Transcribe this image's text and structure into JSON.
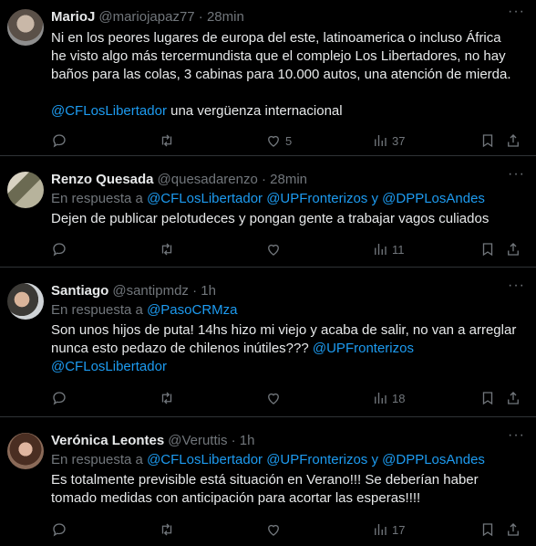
{
  "tweets": [
    {
      "name": "MarioJ",
      "meta": "@mariojapaz77 · 28min",
      "reply_prefix": "",
      "reply_mentions": [],
      "text_lines": [
        "Ni en los peores lugares de europa del este, latinoamerica o incluso África",
        "he visto algo más tercermundista que el complejo Los Libertadores, no hay",
        "baños para las colas, 3 cabinas para 10.000 autos, una atención de mierda."
      ],
      "mention_line": "@CFLosLibertador",
      "mention_tail": " una vergüenza internacional",
      "likes": "5",
      "views": "37",
      "more": "···"
    },
    {
      "name": "Renzo Quesada",
      "meta": "@quesadarenzo · 28min",
      "reply_prefix": "En respuesta a ",
      "reply_m1": "@CFLosLibertador",
      "reply_m2": "@UPFronterizos",
      "reply_y": " y ",
      "reply_m3": "@DPPLosAndes",
      "text": "Dejen de publicar  pelotudeces y pongan gente a trabajar vagos culiados",
      "views": "11",
      "more": "···"
    },
    {
      "name": "Santiago",
      "meta": "@santipmdz · 1h",
      "reply_prefix": "En respuesta a ",
      "reply_m1": "@PasoCRMza",
      "text_line1": "Son unos hijos de puta! 14hs hizo mi viejo y acaba de salir, no van a arreglar",
      "text_line2": "nunca esto pedazo de chilenos inútiles??? ",
      "text_line2_mention": "@UPFronterizos",
      "text_line3_mention": "@CFLosLibertador",
      "views": "18",
      "more": "···"
    },
    {
      "name": "Verónica Leontes",
      "meta": "@Veruttis · 1h",
      "reply_prefix": "En respuesta a ",
      "reply_m1": "@CFLosLibertador",
      "reply_m2": "@UPFronterizos",
      "reply_y": " y ",
      "reply_m3": "@DPPLosAndes",
      "text_line1": "Es totalmente previsible está situación en Verano!!! Se deberían haber",
      "text_line2": "tomado medidas con anticipación para acortar las esperas!!!!",
      "views": "17",
      "more": "···"
    }
  ]
}
